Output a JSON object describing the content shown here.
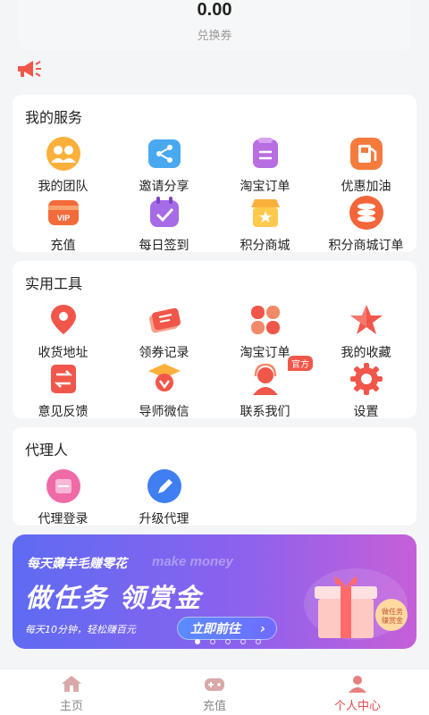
{
  "balance": {
    "value": "0.00",
    "label": "兑换券"
  },
  "notice": {
    "icon": "megaphone-icon"
  },
  "services": {
    "title": "我的服务",
    "items": [
      {
        "label": "我的团队",
        "icon": "team-icon"
      },
      {
        "label": "邀请分享",
        "icon": "share-icon"
      },
      {
        "label": "淘宝订单",
        "icon": "taobao-order-icon"
      },
      {
        "label": "优惠加油",
        "icon": "fuel-icon"
      },
      {
        "label": "充值",
        "icon": "vip-recharge-icon"
      },
      {
        "label": "每日签到",
        "icon": "calendar-checkin-icon"
      },
      {
        "label": "积分商城",
        "icon": "points-mall-icon"
      },
      {
        "label": "积分商城订单",
        "icon": "points-order-icon"
      }
    ]
  },
  "tools": {
    "title": "实用工具",
    "items": [
      {
        "label": "收货地址",
        "icon": "location-pin-icon"
      },
      {
        "label": "领券记录",
        "icon": "coupon-icon"
      },
      {
        "label": "淘宝订单",
        "icon": "clover-icon"
      },
      {
        "label": "我的收藏",
        "icon": "star-icon"
      },
      {
        "label": "意见反馈",
        "icon": "feedback-icon"
      },
      {
        "label": "导师微信",
        "icon": "mentor-icon"
      },
      {
        "label": "联系我们",
        "icon": "customer-service-icon",
        "badge": "官方"
      },
      {
        "label": "设置",
        "icon": "gear-icon"
      }
    ]
  },
  "agent": {
    "title": "代理人",
    "items": [
      {
        "label": "代理登录",
        "icon": "agent-login-icon"
      },
      {
        "label": "升级代理",
        "icon": "pencil-icon"
      }
    ]
  },
  "banner": {
    "tagline": "每天薅羊毛赚零花",
    "watermark": "make money",
    "headline": "做任务 领赏金",
    "subtext": "每天10分钟，轻松赚百元",
    "button": "立即前往",
    "gift_tag": "做任务 赚赏金",
    "slides": 5,
    "active_slide": 1
  },
  "tabbar": {
    "tabs": [
      {
        "label": "主页",
        "icon": "home-icon",
        "active": false
      },
      {
        "label": "充值",
        "icon": "gamepad-icon",
        "active": false
      },
      {
        "label": "个人中心",
        "icon": "person-icon",
        "active": true
      }
    ]
  },
  "colors": {
    "accent": "#e24a4a",
    "banner_start": "#5f6bf2",
    "banner_end": "#c65fd8"
  }
}
